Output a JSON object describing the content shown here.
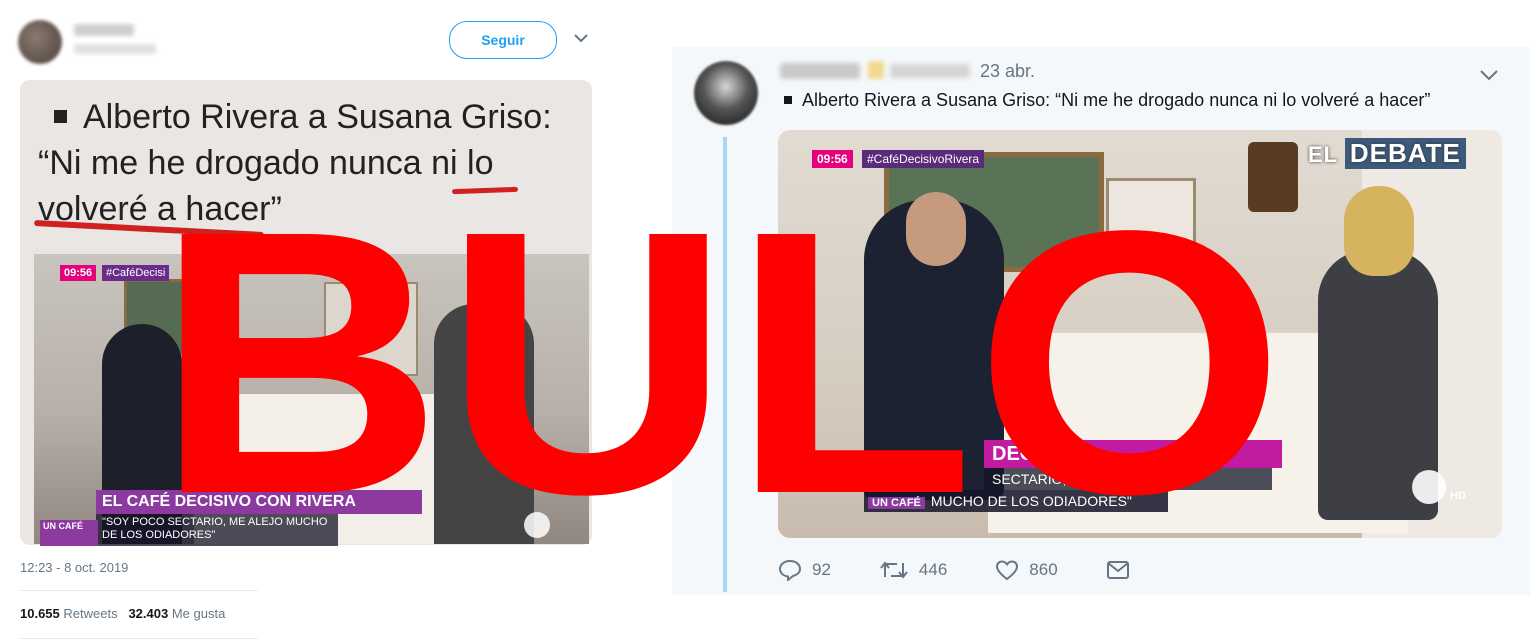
{
  "left_tweet": {
    "follow_label": "Seguir",
    "headline_line1": "Alberto Rivera a Susana Griso:",
    "headline_line2": "“Ni me he drogado nunca ni lo",
    "headline_line3": "volveré a hacer”",
    "video_time": "09:56",
    "video_hashtag": "#CaféDecisi",
    "lower_third_title": "EL CAFÉ DECISIVO CON RIVERA",
    "lower_third_quote": "\"SOY POCO SECTARIO, ME ALEJO MUCHO DE LOS ODIADORES\"",
    "un_cafe": "UN CAFÉ",
    "timestamp": "12:23 - 8 oct. 2019",
    "retweets_count": "10.655",
    "retweets_label": "Retweets",
    "likes_count": "32.403",
    "likes_label": "Me gusta"
  },
  "right_tweet": {
    "date": "23 abr.",
    "text": "Alberto Rivera a Susana Griso: “Ni me he drogado nunca ni lo volveré a hacer”",
    "video_time": "09:56",
    "video_hashtag": "#CaféDecisivoRivera",
    "channel_el": "EL",
    "channel_debate": "DEBATE",
    "lower_third_title": "DECISI",
    "lower_third_sectario": "SECTARIO, ME A",
    "lower_third_odiadores": "MUCHO DE LOS ODIADORES\"",
    "un_cafe": "UN CAFÉ",
    "hd_label": "HD",
    "replies": "92",
    "retweets": "446",
    "likes": "860"
  },
  "overlay": {
    "text": "BULO",
    "color": "#ff0000"
  },
  "colors": {
    "twitter_blue": "#1da1f2",
    "muted_text": "#657786",
    "thread_line": "#a9d8f7"
  },
  "icons": {
    "reply": "reply-icon",
    "retweet": "retweet-icon",
    "like": "heart-icon",
    "dm": "envelope-icon",
    "menu": "chevron-down-icon"
  }
}
